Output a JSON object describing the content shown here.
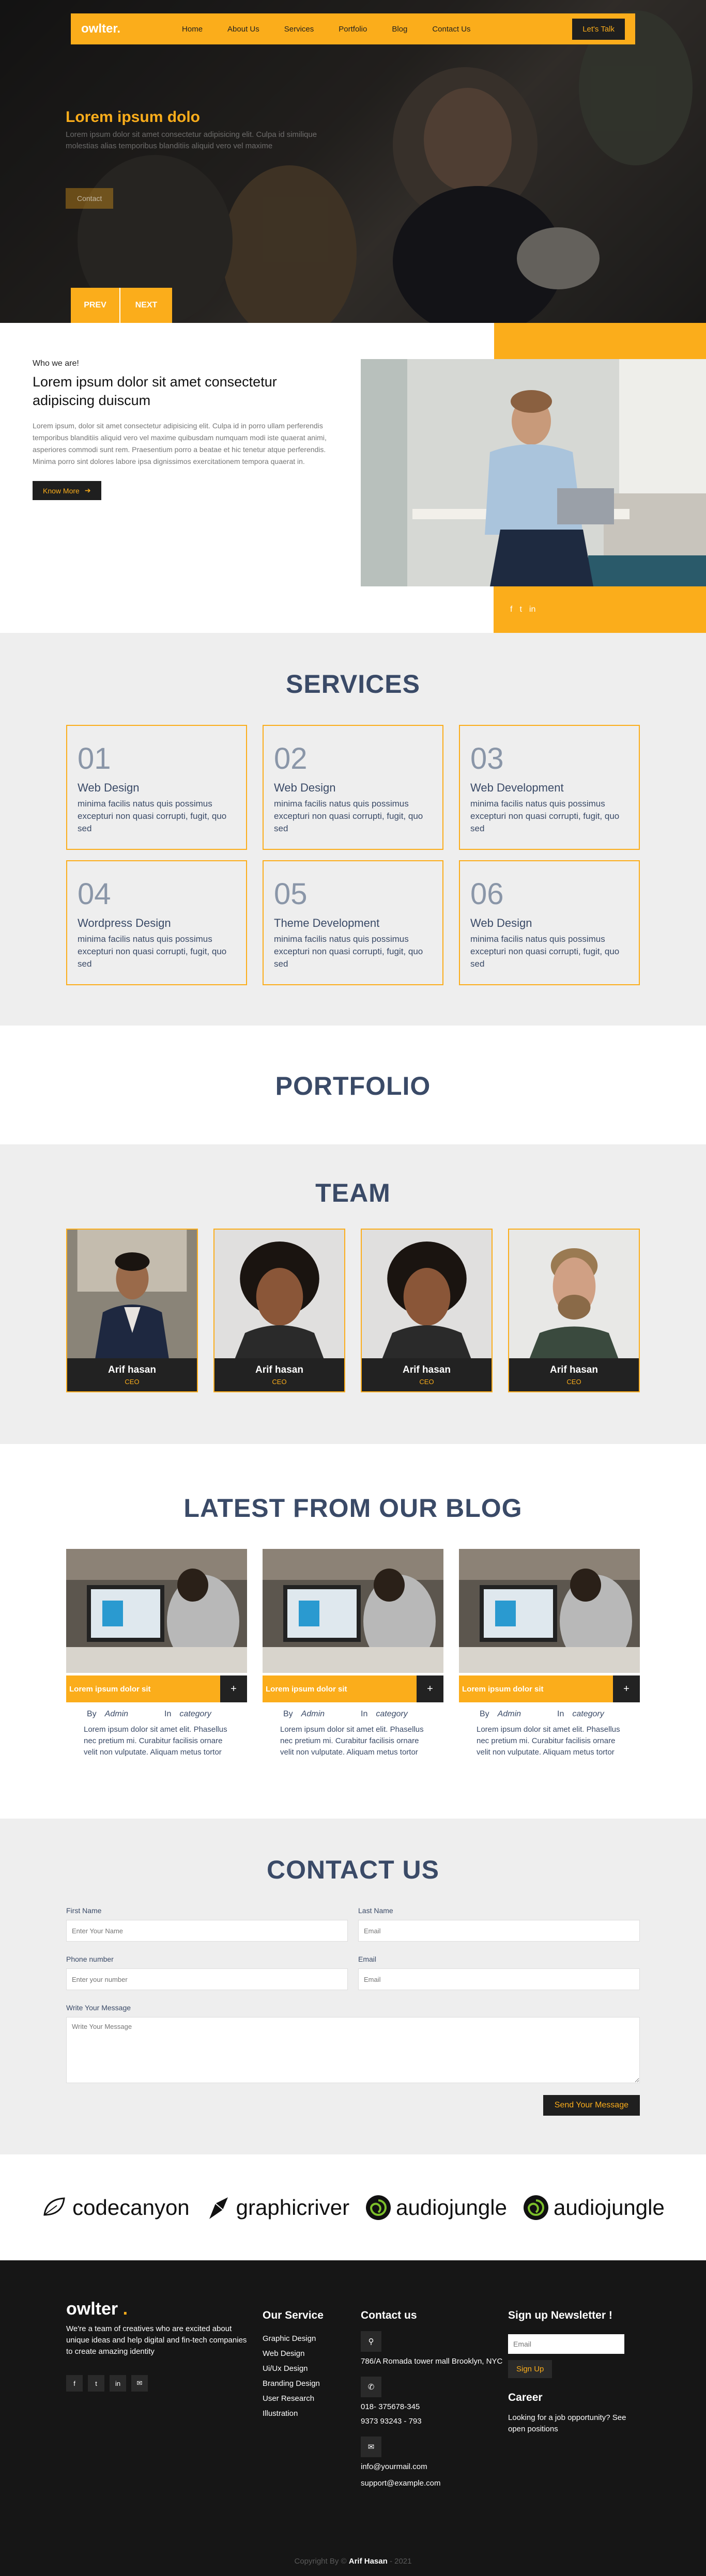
{
  "nav": {
    "logo": "owlter",
    "logo_dot": ".",
    "items": [
      "Home",
      "About Us",
      "Services",
      "Portfolio",
      "Blog",
      "Contact Us"
    ],
    "cta": "Let's Talk"
  },
  "hero": {
    "title": "Lorem ipsum dolo",
    "text": "Lorem ipsum dolor sit amet consectetur adipisicing elit. Culpa id similique molestias alias temporibus blanditiis aliquid vero vel maxime",
    "button": "Contact",
    "prev": "PREV",
    "next": "NEXT"
  },
  "about": {
    "eyebrow": "Who we are!",
    "title": "Lorem ipsum dolor sit amet consectetur adipiscing duiscum",
    "paragraph": "Lorem ipsum, dolor sit amet consectetur adipisicing elit. Culpa id in porro ullam perferendis temporibus blanditiis aliquid vero vel maxime quibusdam numquam modi iste quaerat animi, asperiores commodi sunt rem. Praesentium porro a beatae et hic tenetur atque perferendis. Minima porro sint dolores labore ipsa dignissimos exercitationem tempora quaerat in.",
    "button": "Know More",
    "social": [
      "f",
      "t",
      "in"
    ]
  },
  "services": {
    "title": "SERVICES",
    "items": [
      {
        "num": "01",
        "title": "Web Design",
        "desc": "minima facilis natus quis possimus excepturi non quasi corrupti, fugit, quo sed"
      },
      {
        "num": "02",
        "title": "Web Design",
        "desc": "minima facilis natus quis possimus excepturi non quasi corrupti, fugit, quo sed"
      },
      {
        "num": "03",
        "title": "Web Development",
        "desc": "minima facilis natus quis possimus excepturi non quasi corrupti, fugit, quo sed"
      },
      {
        "num": "04",
        "title": "Wordpress Design",
        "desc": "minima facilis natus quis possimus excepturi non quasi corrupti, fugit, quo sed"
      },
      {
        "num": "05",
        "title": "Theme Development",
        "desc": "minima facilis natus quis possimus excepturi non quasi corrupti, fugit, quo sed"
      },
      {
        "num": "06",
        "title": "Web Design",
        "desc": "minima facilis natus quis possimus excepturi non quasi corrupti, fugit, quo sed"
      }
    ]
  },
  "portfolio": {
    "title": "PORTFOLIO"
  },
  "team": {
    "title": "TEAM",
    "members": [
      {
        "name": "Arif hasan",
        "role": "CEO"
      },
      {
        "name": "Arif hasan",
        "role": "CEO"
      },
      {
        "name": "Arif hasan",
        "role": "CEO"
      },
      {
        "name": "Arif hasan",
        "role": "CEO"
      }
    ]
  },
  "blog": {
    "title": "LATEST FROM OUR BLOG",
    "posts": [
      {
        "title": "Lorem ipsum dolor sit",
        "by_label": "By",
        "by": "Admin",
        "in_label": "In",
        "category": "category",
        "excerpt": "Lorem ipsum dolor sit amet elit. Phasellus nec pretium mi. Curabitur facilisis ornare velit non vulputate. Aliquam metus tortor"
      },
      {
        "title": "Lorem ipsum dolor sit",
        "by_label": "By",
        "by": "Admin",
        "in_label": "In",
        "category": "category",
        "excerpt": "Lorem ipsum dolor sit amet elit. Phasellus nec pretium mi. Curabitur facilisis ornare velit non vulputate. Aliquam metus tortor"
      },
      {
        "title": "Lorem ipsum dolor sit",
        "by_label": "By",
        "by": "Admin",
        "in_label": "In",
        "category": "category",
        "excerpt": "Lorem ipsum dolor sit amet elit. Phasellus nec pretium mi. Curabitur facilisis ornare velit non vulputate. Aliquam metus tortor"
      }
    ]
  },
  "contact": {
    "title": "CONTACT US",
    "first_name_label": "First Name",
    "first_name_placeholder": "Enter Your Name",
    "last_name_label": "Last Name",
    "last_name_placeholder": "Email",
    "phone_label": "Phone number",
    "phone_placeholder": "Enter your number",
    "email_label": "Email",
    "email_placeholder": "Email",
    "message_label": "Write Your Message",
    "message_placeholder": "Write Your Message",
    "submit": "Send Your Message"
  },
  "brands": [
    "codecanyon",
    "graphicriver",
    "audiojungle",
    "audiojungle"
  ],
  "footer": {
    "logo": "owlter",
    "logo_dot": ".",
    "desc": "We're a team of creatives who are excited about unique ideas and help digital and fin-tech companies to create amazing identity",
    "social": [
      "f",
      "t",
      "in",
      "✉"
    ],
    "service_title": "Our Service",
    "services": [
      "Graphic Design",
      "Web Design",
      "Ui/Ux Design",
      "Branding Design",
      "User Research",
      "Illustration"
    ],
    "contact_title": "Contact us",
    "address": "786/A Romada tower mall Brooklyn, NYC",
    "phone1": "018- 375678-345",
    "phone2": "9373 93243 - 793",
    "email1": "info@yourmail.com",
    "email2": "support@example.com",
    "newsletter_title": "Sign up Newsletter !",
    "newsletter_placeholder": "Email",
    "signup": "Sign Up",
    "career_title": "Career",
    "career_text": "Looking for a job opportunity? See open positions",
    "copyright_pre": "Copyright By ©",
    "copyright_name": "Arif Hasan",
    "copyright_year": "- 2021"
  },
  "colors": {
    "accent": "#fbad1b",
    "dark": "#1f1f1f",
    "heading": "#3a4a67",
    "section_bg": "#eeeeee"
  }
}
